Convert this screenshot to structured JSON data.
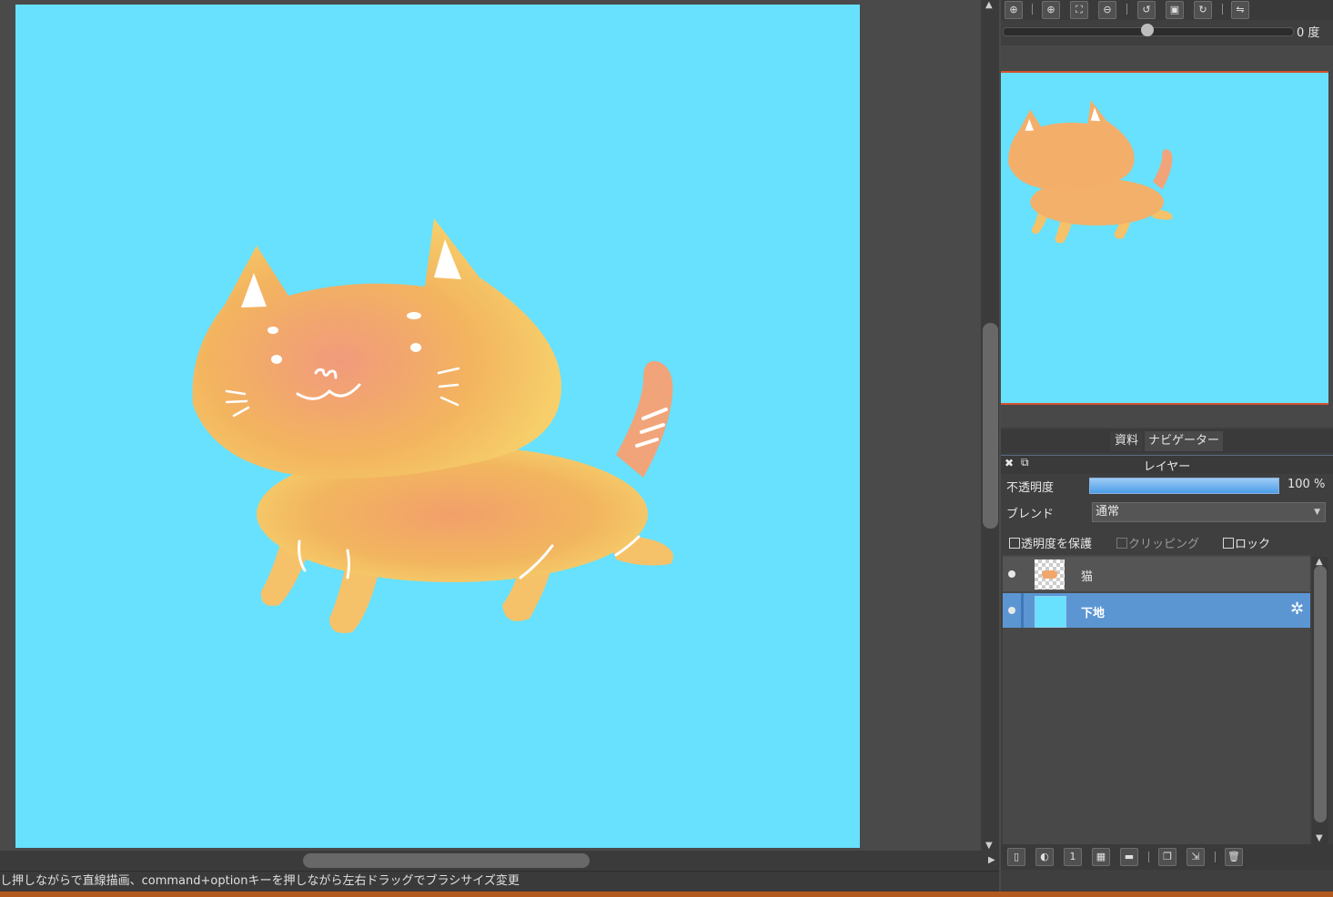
{
  "toolbar": {
    "icons": [
      "zoom-fit-icon",
      "zoom-in-icon",
      "fit-screen-icon",
      "zoom-out-icon",
      "rotate-left-icon",
      "reset-view-icon",
      "rotate-right-icon",
      "flip-icon"
    ],
    "glyphs": [
      "⊕",
      "⊕",
      "⛶",
      "⊖",
      "↺",
      "▣",
      "↻",
      "⇋"
    ]
  },
  "rotation": {
    "label": "0 度",
    "value": 0
  },
  "statusbar": {
    "text": "し押しながらで直線描画、command+optionキーを押しながら左右ドラッグでブラシサイズ変更"
  },
  "panel_tabs": [
    "資料",
    "ナビゲーター"
  ],
  "layer_panel": {
    "title": "レイヤー",
    "opacity_label": "不透明度",
    "opacity_value": "100 %",
    "opacity_fraction": 1.0,
    "blend_label": "ブレンド",
    "blend_value": "通常",
    "protect_alpha": "透明度を保護",
    "clipping": "クリッピング",
    "lock": "ロック",
    "layers": [
      {
        "name": "猫",
        "selected": false
      },
      {
        "name": "下地",
        "selected": true
      }
    ]
  },
  "colors": {
    "canvas_bg": "#67e1fe",
    "selected_layer": "#5b96d3",
    "accent_border": "#d5522a"
  }
}
